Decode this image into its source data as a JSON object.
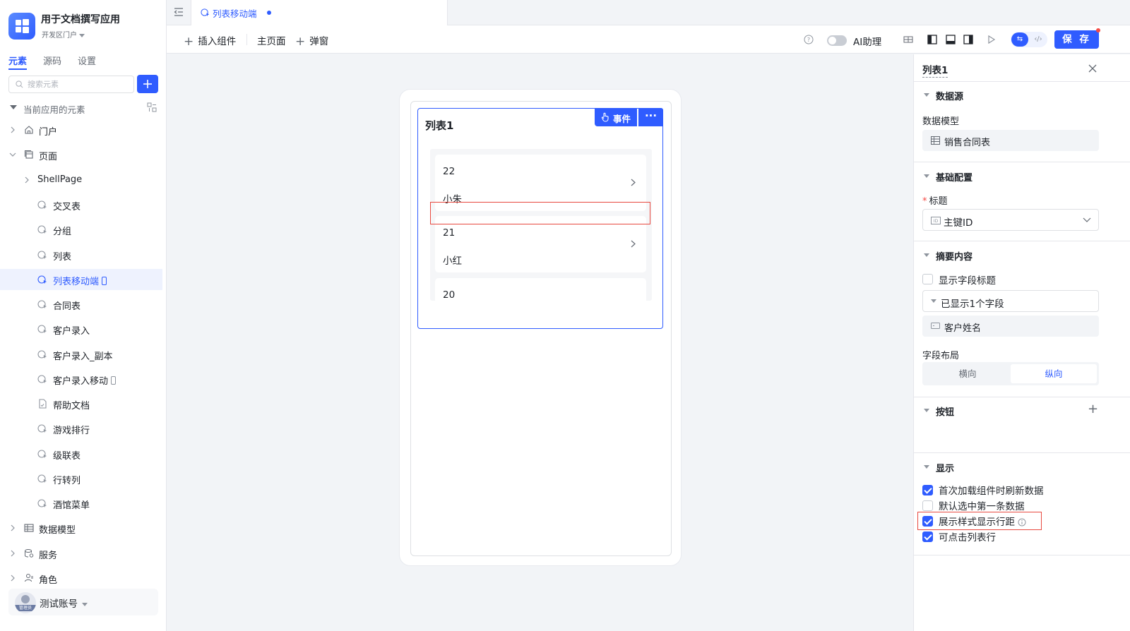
{
  "app": {
    "name": "用于文档撰写应用",
    "env": "开发区门户"
  },
  "sidebar": {
    "tabs": [
      {
        "label": "元素",
        "active": true
      },
      {
        "label": "源码",
        "active": false
      },
      {
        "label": "设置",
        "active": false
      }
    ],
    "search_placeholder": "搜索元素",
    "tree_header": "当前应用的元素",
    "items": [
      {
        "label": "门户",
        "icon": "home-icon",
        "level": 0,
        "expanded": false
      },
      {
        "label": "页面",
        "icon": "pages-icon",
        "level": 0,
        "expanded": true
      },
      {
        "label": "ShellPage",
        "icon": "",
        "level": 1,
        "expanded": false
      },
      {
        "label": "交叉表",
        "icon": "page-icon",
        "level": 2
      },
      {
        "label": "分组",
        "icon": "page-icon",
        "level": 2
      },
      {
        "label": "列表",
        "icon": "page-icon",
        "level": 2
      },
      {
        "label": "列表移动端",
        "icon": "page-icon",
        "level": 2,
        "active": true,
        "mobile": true
      },
      {
        "label": "合同表",
        "icon": "page-icon",
        "level": 2
      },
      {
        "label": "客户录入",
        "icon": "page-icon",
        "level": 2
      },
      {
        "label": "客户录入_副本",
        "icon": "page-icon",
        "level": 2
      },
      {
        "label": "客户录入移动",
        "icon": "page-icon",
        "level": 2,
        "mobile": true
      },
      {
        "label": "帮助文档",
        "icon": "doc-icon",
        "level": 2
      },
      {
        "label": "游戏排行",
        "icon": "page-icon",
        "level": 2
      },
      {
        "label": "级联表",
        "icon": "page-icon",
        "level": 2
      },
      {
        "label": "行转列",
        "icon": "page-icon",
        "level": 2
      },
      {
        "label": "酒馆菜单",
        "icon": "page-icon",
        "level": 2
      },
      {
        "label": "数据模型",
        "icon": "table-icon",
        "level": 0,
        "expanded": false
      },
      {
        "label": "服务",
        "icon": "service-icon",
        "level": 0,
        "expanded": false
      },
      {
        "label": "角色",
        "icon": "role-icon",
        "level": 0,
        "expanded": false
      }
    ],
    "account": {
      "name": "测试账号",
      "badge": "管理员"
    }
  },
  "topbar": {
    "tab_label": "列表移动端"
  },
  "toolbar": {
    "insert_label": "插入组件",
    "home_label": "主页面",
    "popup_label": "弹窗",
    "ai_label": "AI助理",
    "save_label": "保 存"
  },
  "canvas": {
    "list_title": "列表1",
    "event_label": "事件",
    "more_label": "···",
    "cards": [
      {
        "id": "22",
        "name": "小朱"
      },
      {
        "id": "21",
        "name": "小红"
      },
      {
        "id": "20",
        "name": ""
      }
    ]
  },
  "panel": {
    "title": "列表1",
    "sections": {
      "datasource": "数据源",
      "basic": "基础配置",
      "summary": "摘要内容",
      "buttons": "按钮",
      "display": "显示"
    },
    "data_model_label": "数据模型",
    "data_model_value": "销售合同表",
    "title_label": "标题",
    "title_value": "主键ID",
    "show_field_title": "显示字段标题",
    "shown_fields": "已显示1个字段",
    "field_customer": "客户姓名",
    "layout_label": "字段布局",
    "layout_options": [
      "横向",
      "纵向"
    ],
    "layout_selected": "纵向",
    "display_options": [
      {
        "label": "首次加载组件时刷新数据",
        "checked": true
      },
      {
        "label": "默认选中第一条数据",
        "checked": false
      },
      {
        "label": "展示样式显示行距",
        "checked": true
      },
      {
        "label": "可点击列表行",
        "checked": true
      }
    ]
  },
  "colors": {
    "accent": "#2f5cff",
    "highlight": "#e8493f"
  }
}
